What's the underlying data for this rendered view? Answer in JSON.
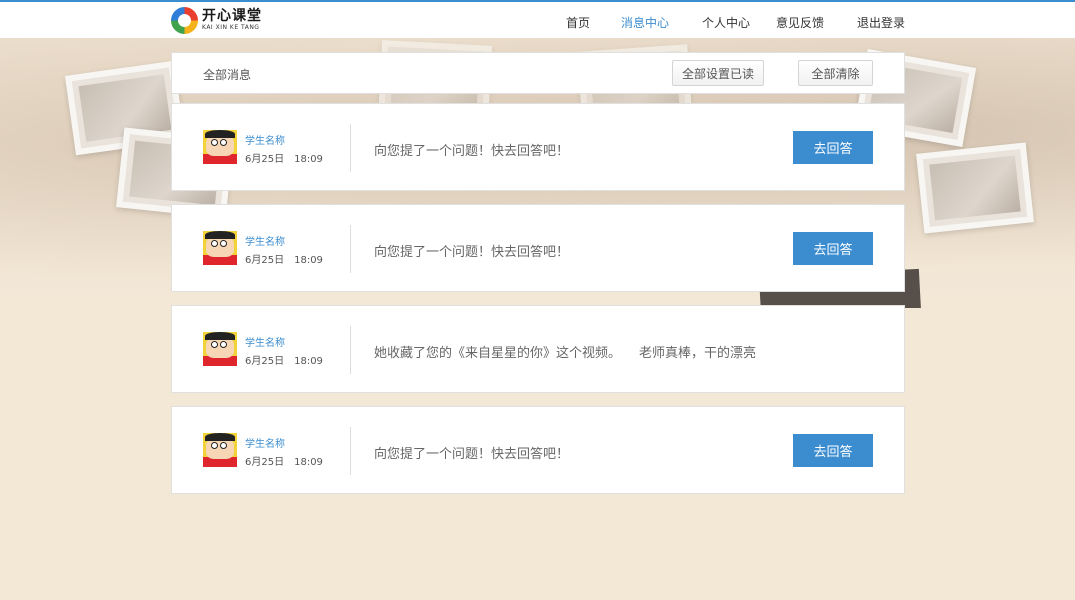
{
  "header": {
    "logo_cn": "开心课堂",
    "logo_en": "KAI XIN KE TANG",
    "nav": [
      {
        "label": "首页",
        "active": false
      },
      {
        "label": "消息中心",
        "active": true
      },
      {
        "label": "个人中心",
        "active": false
      },
      {
        "label": "意见反馈",
        "active": false
      },
      {
        "label": "退出登录",
        "active": false
      }
    ]
  },
  "toolbar": {
    "title": "全部消息",
    "mark_all_read": "全部设置已读",
    "clear_all": "全部清除"
  },
  "messages": [
    {
      "sender": "学生名称",
      "date": "6月25日",
      "time": "18:09",
      "text": "向您提了一个问题！快去回答吧！",
      "extra": "",
      "button": "去回答"
    },
    {
      "sender": "学生名称",
      "date": "6月25日",
      "time": "18:09",
      "text": "向您提了一个问题！快去回答吧！",
      "extra": "",
      "button": "去回答"
    },
    {
      "sender": "学生名称",
      "date": "6月25日",
      "time": "18:09",
      "text": "她收藏了您的《来自星星的你》这个视频。",
      "extra": "老师真棒，干的漂亮",
      "button": ""
    },
    {
      "sender": "学生名称",
      "date": "6月25日",
      "time": "18:09",
      "text": "向您提了一个问题！快去回答吧！",
      "extra": "",
      "button": "去回答"
    }
  ],
  "colors": {
    "accent": "#3c8dd0",
    "background": "#f3e7d6",
    "answer_button": "#3c8dd0"
  }
}
